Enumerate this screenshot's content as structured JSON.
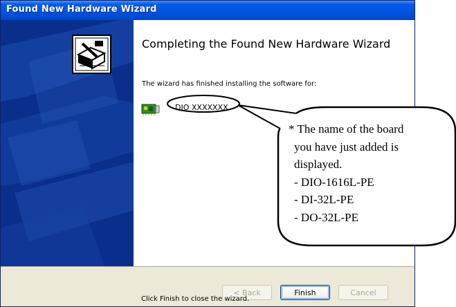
{
  "window": {
    "title": "Found New Hardware Wizard"
  },
  "wizard": {
    "heading": "Completing the Found New Hardware Wizard",
    "intro": "The wizard has finished installing the software for:",
    "device_name": "DIO XXXXXXX",
    "finish_hint": "Click Finish to close the wizard."
  },
  "buttons": {
    "back": "< Back",
    "finish": "Finish",
    "cancel": "Cancel"
  },
  "annotation": {
    "lines": [
      "* The name of the board",
      "you have just added is",
      "displayed.",
      "- DIO-1616L-PE",
      "- DI-32L-PE",
      "- DO-32L-PE"
    ]
  },
  "icons": {
    "wizard_art": "hardware-box-icon",
    "device": "circuit-board-icon"
  },
  "colors": {
    "title_bar": "#0054e3",
    "side_panel": "#0a2e8c",
    "dialog_face": "#ece9d8"
  }
}
